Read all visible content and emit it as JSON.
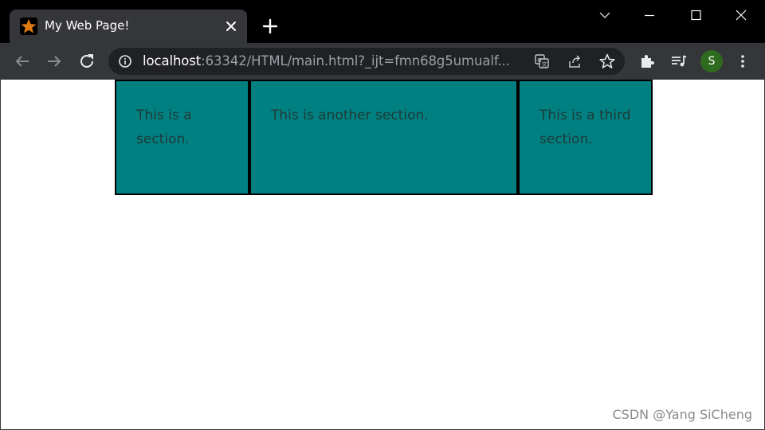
{
  "browser": {
    "tab": {
      "title": "My Web Page!",
      "favicon": "star-icon"
    },
    "window_controls": [
      "chevron-down-icon",
      "minimize-icon",
      "maximize-icon",
      "close-icon"
    ],
    "address_bar": {
      "host": "localhost",
      "rest": ":63342/HTML/main.html?_ijt=fmn68g5umualf..."
    },
    "profile_initial": "S"
  },
  "page": {
    "sections": [
      {
        "text": "This is a section."
      },
      {
        "text": "This is another section."
      },
      {
        "text": "This is a third section."
      }
    ],
    "section_color": "#008080"
  },
  "watermark": "CSDN @Yang SiCheng"
}
